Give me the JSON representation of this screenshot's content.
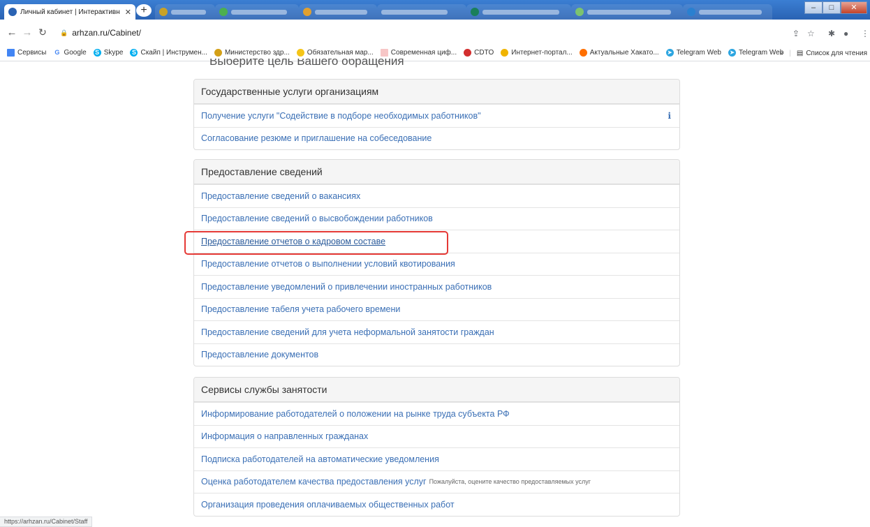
{
  "browser": {
    "active_tab_title": "Личный кабинет | Интерактивн",
    "url": "arhzan.ru/Cabinet/",
    "status_url": "https://arhzan.ru/Cabinet/Staff",
    "bookmarks": [
      "Сервисы",
      "Google",
      "Skype",
      "Скайп | Инструмен...",
      "Министерство здр...",
      "Обязательная мар...",
      "Современная циф...",
      "CDTO",
      "Интернет-портал...",
      "Актуальные Хакато...",
      "Telegram Web",
      "Telegram Web"
    ],
    "reading_list": "Список для чтения",
    "colors": {
      "tabstrip": "#2a63b3",
      "link": "#3a6fb5",
      "highlight": "#e53935"
    }
  },
  "page": {
    "heading": "Выберите цель Вашего обращения",
    "sections": [
      {
        "title": "Государственные услуги организациям",
        "items": [
          {
            "label": "Получение услуги \"Содействие в подборе необходимых работников\"",
            "info": "i"
          },
          {
            "label": "Согласование резюме и приглашение на собеседование"
          }
        ]
      },
      {
        "title": "Предоставление сведений",
        "items": [
          {
            "label": "Предоставление сведений о вакансиях"
          },
          {
            "label": "Предоставление сведений о высвобождении работников"
          },
          {
            "label": "Предоставление отчетов о кадровом составе"
          },
          {
            "label": "Предоставление отчетов о выполнении условий квотирования"
          },
          {
            "label": "Предоставление уведомлений о привлечении иностранных работников"
          },
          {
            "label": "Предоставление табеля учета рабочего времени"
          },
          {
            "label": "Предоставление сведений для учета неформальной занятости граждан"
          },
          {
            "label": "Предоставление документов"
          }
        ]
      },
      {
        "title": "Сервисы службы занятости",
        "items": [
          {
            "label": "Информирование работодателей о положении на рынке труда субъекта РФ"
          },
          {
            "label": "Информация о направленных гражданах"
          },
          {
            "label": "Подписка работодателей на автоматические уведомления"
          },
          {
            "label": "Оценка работодателем качества предоставления услуг",
            "hint": "Пожалуйста, оцените качество предоставляемых услуг"
          },
          {
            "label": "Организация проведения оплачиваемых общественных работ"
          }
        ]
      }
    ]
  }
}
